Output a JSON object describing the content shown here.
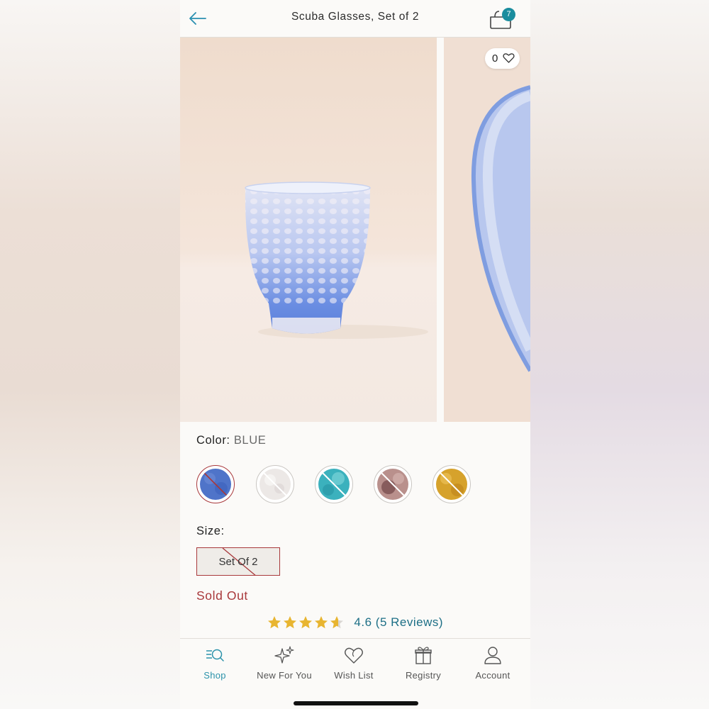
{
  "header": {
    "title": "Scuba Glasses, Set of 2",
    "back_icon": "arrow-left-icon",
    "cart_icon": "shopping-basket-icon",
    "cart_count": "7"
  },
  "gallery": {
    "favorite_count": "0",
    "favorite_icon": "heart-outline-icon",
    "images": [
      "blue speckled glass tumbler",
      "close-up of blue speckled glass rim"
    ]
  },
  "color": {
    "label": "Color:",
    "value": "BLUE",
    "swatches": [
      {
        "name": "blue",
        "color": "#4f74c9",
        "selected": true,
        "unavailable": true
      },
      {
        "name": "white",
        "color": "#ece8e6",
        "selected": false,
        "unavailable": true
      },
      {
        "name": "teal",
        "color": "#3bb1bd",
        "selected": false,
        "unavailable": true
      },
      {
        "name": "mauve",
        "color": "#9c6e6c",
        "selected": false,
        "unavailable": true
      },
      {
        "name": "amber",
        "color": "#d6a22c",
        "selected": false,
        "unavailable": true
      }
    ]
  },
  "size": {
    "label": "Size:",
    "option": "Set Of 2",
    "unavailable": true
  },
  "availability": "Sold Out",
  "rating": {
    "value": 4.6,
    "text": "4.6 (5 Reviews)",
    "star_color": "#e8b531",
    "max_stars": 5
  },
  "tabbar": {
    "tabs": [
      {
        "label": "Shop",
        "icon": "search-list-icon",
        "active": true
      },
      {
        "label": "New For You",
        "icon": "sparkles-icon",
        "active": false
      },
      {
        "label": "Wish List",
        "icon": "heart-icon",
        "active": false
      },
      {
        "label": "Registry",
        "icon": "gift-icon",
        "active": false
      },
      {
        "label": "Account",
        "icon": "user-icon",
        "active": false
      }
    ]
  },
  "colors": {
    "accent_teal": "#1a8d9e",
    "sold_out_red": "#a8383b",
    "link_blue": "#1d6f86",
    "active_tab": "#2a92aa"
  }
}
